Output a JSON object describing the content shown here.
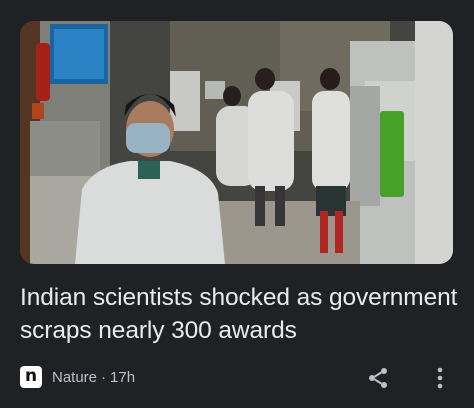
{
  "article": {
    "image_alt": "Scientists working in a laboratory",
    "headline": "Indian scientists shocked as government scraps nearly 300 awards",
    "source_logo_letter": "n",
    "source_name": "Nature",
    "separator": "·",
    "age": "17h",
    "share_icon": "share-icon",
    "more_icon": "more-vert-icon"
  },
  "colors": {
    "background": "#202124",
    "headline_text": "#e8eaed",
    "meta_text": "#bdc1c6"
  }
}
